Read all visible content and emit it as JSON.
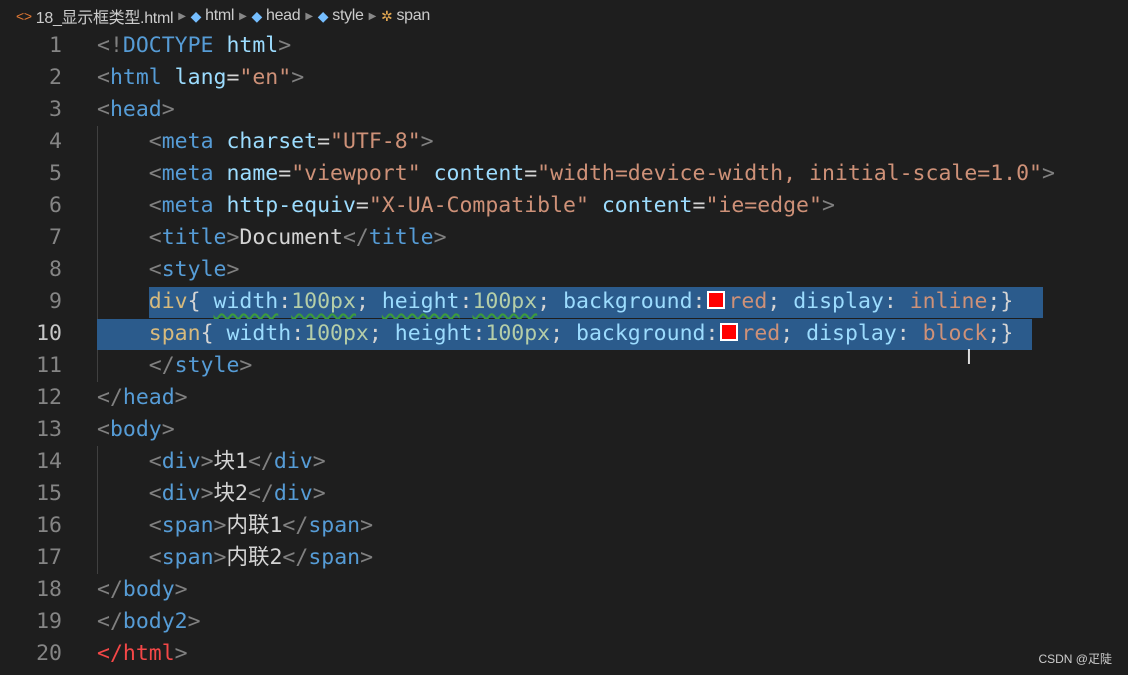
{
  "breadcrumb": [
    {
      "label": "18_显示框类型.html",
      "icon": "html-file-icon",
      "color": "#e37933"
    },
    {
      "label": "html",
      "icon": "element-cube-icon",
      "color": "#75beff"
    },
    {
      "label": "head",
      "icon": "element-cube-icon",
      "color": "#75beff"
    },
    {
      "label": "style",
      "icon": "element-cube-icon",
      "color": "#75beff"
    },
    {
      "label": "span",
      "icon": "css-selector-icon",
      "color": "#e8ab53"
    }
  ],
  "current_line": 10,
  "selection_color": "#2b5b8c",
  "lines": [
    {
      "n": "1",
      "tokens": [
        {
          "t": "<!",
          "c": "b"
        },
        {
          "t": "DOCTYPE",
          "c": "tg"
        },
        {
          "t": " html",
          "c": "at"
        },
        {
          "t": ">",
          "c": "b"
        }
      ]
    },
    {
      "n": "2",
      "tokens": [
        {
          "t": "<",
          "c": "b"
        },
        {
          "t": "html",
          "c": "tg"
        },
        {
          "t": " lang",
          "c": "at"
        },
        {
          "t": "=",
          "c": "tx"
        },
        {
          "t": "\"en\"",
          "c": "st"
        },
        {
          "t": ">",
          "c": "b"
        }
      ]
    },
    {
      "n": "3",
      "tokens": [
        {
          "t": "<",
          "c": "b"
        },
        {
          "t": "head",
          "c": "tg"
        },
        {
          "t": ">",
          "c": "b"
        }
      ]
    },
    {
      "n": "4",
      "tokens": [
        {
          "t": "    <",
          "c": "b"
        },
        {
          "t": "meta",
          "c": "tg"
        },
        {
          "t": " charset",
          "c": "at"
        },
        {
          "t": "=",
          "c": "tx"
        },
        {
          "t": "\"UTF-8\"",
          "c": "st"
        },
        {
          "t": ">",
          "c": "b"
        }
      ]
    },
    {
      "n": "5",
      "tokens": [
        {
          "t": "    <",
          "c": "b"
        },
        {
          "t": "meta",
          "c": "tg"
        },
        {
          "t": " name",
          "c": "at"
        },
        {
          "t": "=",
          "c": "tx"
        },
        {
          "t": "\"viewport\"",
          "c": "st"
        },
        {
          "t": " content",
          "c": "at"
        },
        {
          "t": "=",
          "c": "tx"
        },
        {
          "t": "\"width=device-width, initial-scale=1.0\"",
          "c": "st"
        },
        {
          "t": ">",
          "c": "b"
        }
      ]
    },
    {
      "n": "6",
      "tokens": [
        {
          "t": "    <",
          "c": "b"
        },
        {
          "t": "meta",
          "c": "tg"
        },
        {
          "t": " http-equiv",
          "c": "at"
        },
        {
          "t": "=",
          "c": "tx"
        },
        {
          "t": "\"X-UA-Compatible\"",
          "c": "st"
        },
        {
          "t": " content",
          "c": "at"
        },
        {
          "t": "=",
          "c": "tx"
        },
        {
          "t": "\"ie=edge\"",
          "c": "st"
        },
        {
          "t": ">",
          "c": "b"
        }
      ]
    },
    {
      "n": "7",
      "tokens": [
        {
          "t": "    <",
          "c": "b"
        },
        {
          "t": "title",
          "c": "tg"
        },
        {
          "t": ">",
          "c": "b"
        },
        {
          "t": "Document",
          "c": "tx"
        },
        {
          "t": "</",
          "c": "b"
        },
        {
          "t": "title",
          "c": "tg"
        },
        {
          "t": ">",
          "c": "b"
        }
      ]
    },
    {
      "n": "8",
      "tokens": [
        {
          "t": "    <",
          "c": "b"
        },
        {
          "t": "style",
          "c": "tg"
        },
        {
          "t": ">",
          "c": "b"
        }
      ]
    },
    {
      "n": "9",
      "sel": [
        149,
        1043
      ],
      "tokens": [
        {
          "t": "    "
        },
        {
          "t": "div",
          "c": "sl"
        },
        {
          "t": "{ ",
          "c": "tx"
        },
        {
          "t": "width",
          "c": "pr sq"
        },
        {
          "t": ":",
          "c": "tx"
        },
        {
          "t": "100px",
          "c": "nm sq"
        },
        {
          "t": "; ",
          "c": "tx"
        },
        {
          "t": "height",
          "c": "pr sq"
        },
        {
          "t": ":",
          "c": "tx"
        },
        {
          "t": "100px",
          "c": "nm sq"
        },
        {
          "t": "; ",
          "c": "tx"
        },
        {
          "t": "background",
          "c": "pr"
        },
        {
          "t": ":",
          "c": "tx"
        },
        {
          "swatch": "#ff0000"
        },
        {
          "t": "red",
          "c": "vl"
        },
        {
          "t": "; ",
          "c": "tx"
        },
        {
          "t": "display",
          "c": "pr"
        },
        {
          "t": ": ",
          "c": "tx"
        },
        {
          "t": "inline",
          "c": "vl"
        },
        {
          "t": ";}",
          "c": "tx"
        }
      ]
    },
    {
      "n": "10",
      "sel": [
        97,
        1032
      ],
      "tokens": [
        {
          "t": "    "
        },
        {
          "t": "span",
          "c": "sl"
        },
        {
          "t": "{ ",
          "c": "tx"
        },
        {
          "t": "width",
          "c": "pr"
        },
        {
          "t": ":",
          "c": "tx"
        },
        {
          "t": "100px",
          "c": "nm"
        },
        {
          "t": "; ",
          "c": "tx"
        },
        {
          "t": "height",
          "c": "pr"
        },
        {
          "t": ":",
          "c": "tx"
        },
        {
          "t": "100px",
          "c": "nm"
        },
        {
          "t": "; ",
          "c": "tx"
        },
        {
          "t": "background",
          "c": "pr"
        },
        {
          "t": ":",
          "c": "tx"
        },
        {
          "swatch": "#ff0000"
        },
        {
          "t": "red",
          "c": "vl"
        },
        {
          "t": "; ",
          "c": "tx"
        },
        {
          "t": "display",
          "c": "pr"
        },
        {
          "t": ": ",
          "c": "tx"
        },
        {
          "t": "block",
          "c": "vl"
        },
        {
          "t": ";}",
          "c": "tx"
        }
      ]
    },
    {
      "n": "11",
      "tokens": [
        {
          "t": "    </",
          "c": "b"
        },
        {
          "t": "style",
          "c": "tg"
        },
        {
          "t": ">",
          "c": "b"
        }
      ]
    },
    {
      "n": "12",
      "tokens": [
        {
          "t": "</",
          "c": "b"
        },
        {
          "t": "head",
          "c": "tg"
        },
        {
          "t": ">",
          "c": "b"
        }
      ]
    },
    {
      "n": "13",
      "tokens": [
        {
          "t": "<",
          "c": "b"
        },
        {
          "t": "body",
          "c": "tg"
        },
        {
          "t": ">",
          "c": "b"
        }
      ]
    },
    {
      "n": "14",
      "tokens": [
        {
          "t": "    <",
          "c": "b"
        },
        {
          "t": "div",
          "c": "tg"
        },
        {
          "t": ">",
          "c": "b"
        },
        {
          "t": "块1",
          "c": "tx"
        },
        {
          "t": "</",
          "c": "b"
        },
        {
          "t": "div",
          "c": "tg"
        },
        {
          "t": ">",
          "c": "b"
        }
      ]
    },
    {
      "n": "15",
      "tokens": [
        {
          "t": "    <",
          "c": "b"
        },
        {
          "t": "div",
          "c": "tg"
        },
        {
          "t": ">",
          "c": "b"
        },
        {
          "t": "块2",
          "c": "tx"
        },
        {
          "t": "</",
          "c": "b"
        },
        {
          "t": "div",
          "c": "tg"
        },
        {
          "t": ">",
          "c": "b"
        }
      ]
    },
    {
      "n": "16",
      "tokens": [
        {
          "t": "    <",
          "c": "b"
        },
        {
          "t": "span",
          "c": "tg"
        },
        {
          "t": ">",
          "c": "b"
        },
        {
          "t": "内联1",
          "c": "tx"
        },
        {
          "t": "</",
          "c": "b"
        },
        {
          "t": "span",
          "c": "tg"
        },
        {
          "t": ">",
          "c": "b"
        }
      ]
    },
    {
      "n": "17",
      "tokens": [
        {
          "t": "    <",
          "c": "b"
        },
        {
          "t": "span",
          "c": "tg"
        },
        {
          "t": ">",
          "c": "b"
        },
        {
          "t": "内联2",
          "c": "tx"
        },
        {
          "t": "</",
          "c": "b"
        },
        {
          "t": "span",
          "c": "tg"
        },
        {
          "t": ">",
          "c": "b"
        }
      ]
    },
    {
      "n": "18",
      "tokens": [
        {
          "t": "</",
          "c": "b"
        },
        {
          "t": "body",
          "c": "tg"
        },
        {
          "t": ">",
          "c": "b"
        }
      ]
    },
    {
      "n": "19",
      "tokens": [
        {
          "t": "</",
          "c": "b"
        },
        {
          "t": "body2",
          "c": "tg"
        },
        {
          "t": ">",
          "c": "b"
        }
      ]
    },
    {
      "n": "20",
      "tokens": [
        {
          "t": "</",
          "c": "er"
        },
        {
          "t": "html",
          "c": "er"
        },
        {
          "t": ">",
          "c": "b"
        }
      ]
    }
  ],
  "watermark": "CSDN @疋陡"
}
